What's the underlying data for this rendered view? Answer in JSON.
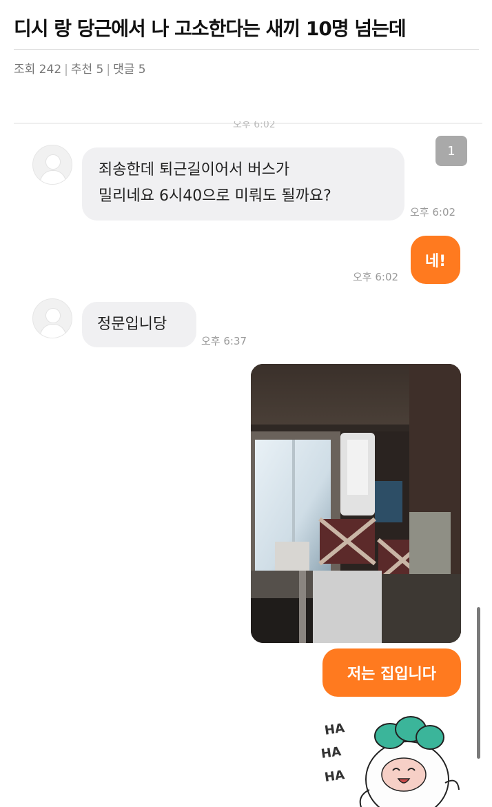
{
  "post": {
    "title": "디시 랑 당근에서 나 고소한다는 새끼 10명 넘는데",
    "meta": {
      "views": "조회 242",
      "recommends": "추천 5",
      "comments": "댓글 5"
    }
  },
  "chat": {
    "cut_time": "오후 6:02",
    "unread_count": "1",
    "messages": [
      {
        "side": "in",
        "line1": "죄송한데 퇴근길이어서 버스가",
        "line2": "밀리네요 6시40으로 미뤄도 될까요?",
        "time": "오후 6:02"
      },
      {
        "side": "out",
        "text": "네!",
        "time": "오후 6:02"
      },
      {
        "side": "in",
        "text": "정문입니당",
        "time": "오후 6:37"
      },
      {
        "side": "out",
        "text": "저는 집입니다"
      }
    ],
    "sticker": {
      "ha": [
        "HA",
        "HA",
        "HA"
      ]
    }
  },
  "colors": {
    "accent_orange": "#ff7a1f",
    "incoming_bubble": "#f0f0f2",
    "badge_gray": "#a9a9a9"
  }
}
